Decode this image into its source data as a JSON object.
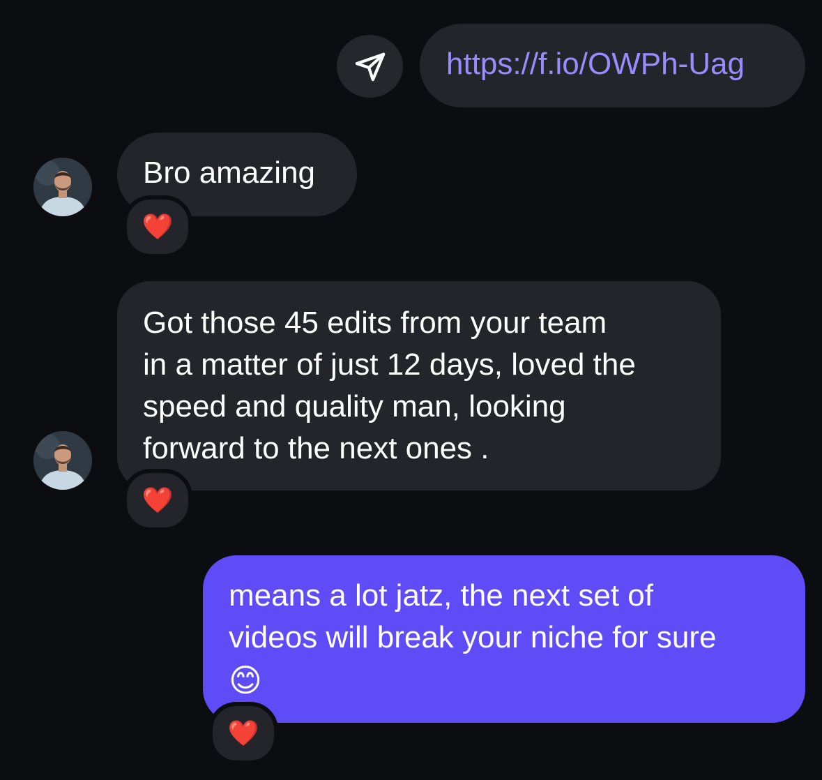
{
  "messages": {
    "link": {
      "text": "https://f.io/OWPh-Uag"
    },
    "incoming_1": {
      "text": "Bro amazing",
      "reaction": "❤️"
    },
    "incoming_2": {
      "lines": [
        "Got those 45 edits from your team",
        "in a matter of just 12 days, loved the",
        "speed and quality man, looking",
        "forward to the next ones ."
      ],
      "reaction": "❤️"
    },
    "outgoing_1": {
      "lines": [
        "means a lot jatz, the next set of",
        "videos will break your niche for sure"
      ],
      "emoji": "😊",
      "reaction": "❤️"
    }
  },
  "icons": {
    "share": "send-icon",
    "avatar": "avatar"
  },
  "colors": {
    "background": "#0c0d10",
    "incoming_bubble": "#24252b",
    "outgoing_bubble": "#5f4cf6",
    "link_text": "#9a8cff"
  }
}
